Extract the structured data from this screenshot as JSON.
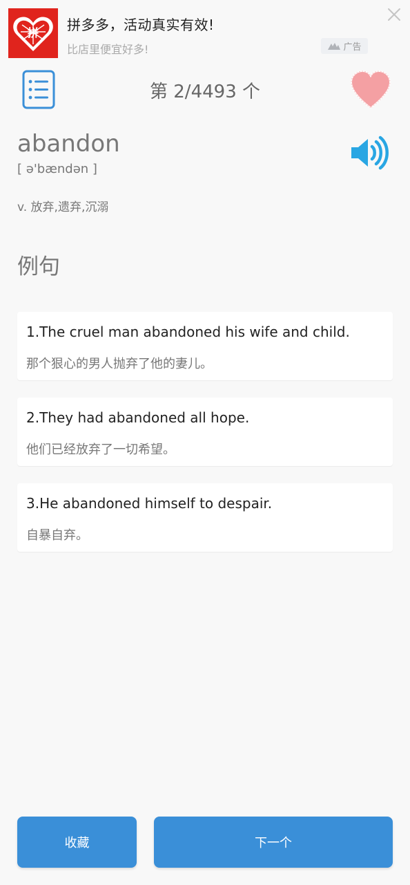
{
  "ad": {
    "title": "拼多多，活动真实有效!",
    "subtitle": "比店里便宜好多!",
    "badge_label": "广告",
    "logo_text": "拼",
    "logo_icon": "pinduoduo-logo",
    "close_icon": "close-icon",
    "brand_color": "#e0241d"
  },
  "header": {
    "counter": "第 2/4493 个",
    "menu_icon": "list-menu-icon",
    "favorite_icon": "heart-icon",
    "accent_color": "#3a8fd8",
    "heart_color": "#f4a0a3"
  },
  "word": {
    "headword": "abandon",
    "phonetic": "[ ə'bændən ]",
    "definition": "v. 放弃,遗弃,沉溺",
    "speaker_icon": "speaker-icon"
  },
  "examples_section": {
    "title": "例句",
    "items": [
      {
        "en": "1.The cruel man abandoned his wife and child.",
        "zh": "那个狠心的男人抛弃了他的妻儿。"
      },
      {
        "en": "2.They had abandoned all hope.",
        "zh": "他们已经放弃了一切希望。"
      },
      {
        "en": "3.He abandoned himself to despair.",
        "zh": "自暴自弃。"
      }
    ]
  },
  "footer": {
    "favorite_label": "收藏",
    "next_label": "下一个"
  }
}
